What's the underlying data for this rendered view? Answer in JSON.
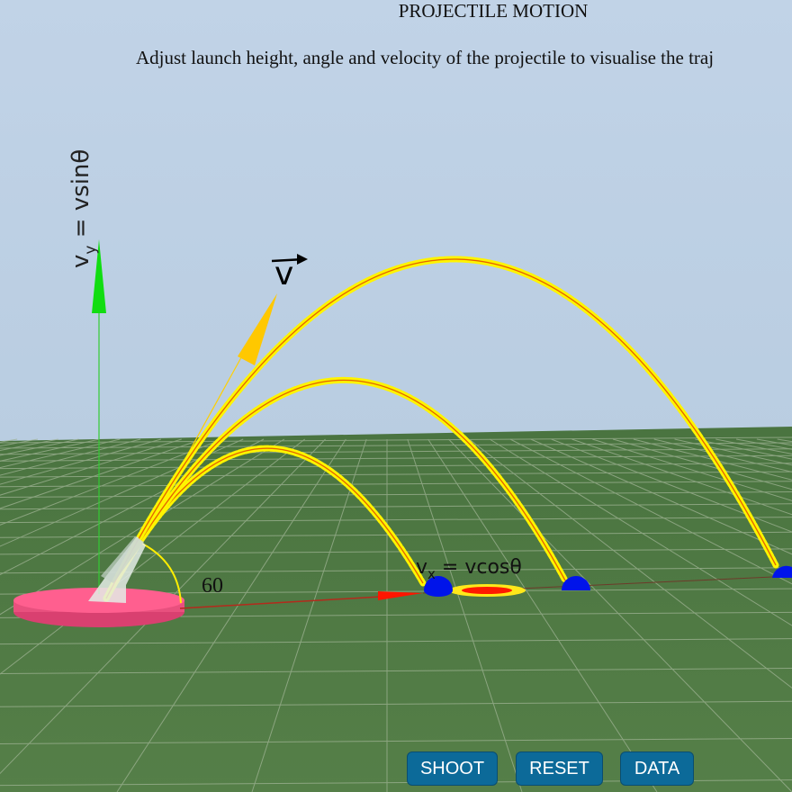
{
  "title": "PROJECTILE MOTION",
  "subtitle": "Adjust launch height, angle and velocity of the projectile to visualise the traj",
  "labels": {
    "vy": "vy = vsinθ",
    "vx": "vx = vcosθ",
    "v": "v",
    "angle": "60"
  },
  "buttons": {
    "shoot": "SHOOT",
    "reset": "RESET",
    "data": "DATA"
  },
  "colors": {
    "sky": "#bdd0e4",
    "ground": "#4f7a45",
    "trajectory": "#ffee00",
    "ball": "#0016e8",
    "launch_pad": "#ff5a8c",
    "vy_arrow": "#00e000",
    "v_arrow": "#ffc800",
    "vx_arrow": "#ff0000",
    "button": "#0c6a99"
  }
}
